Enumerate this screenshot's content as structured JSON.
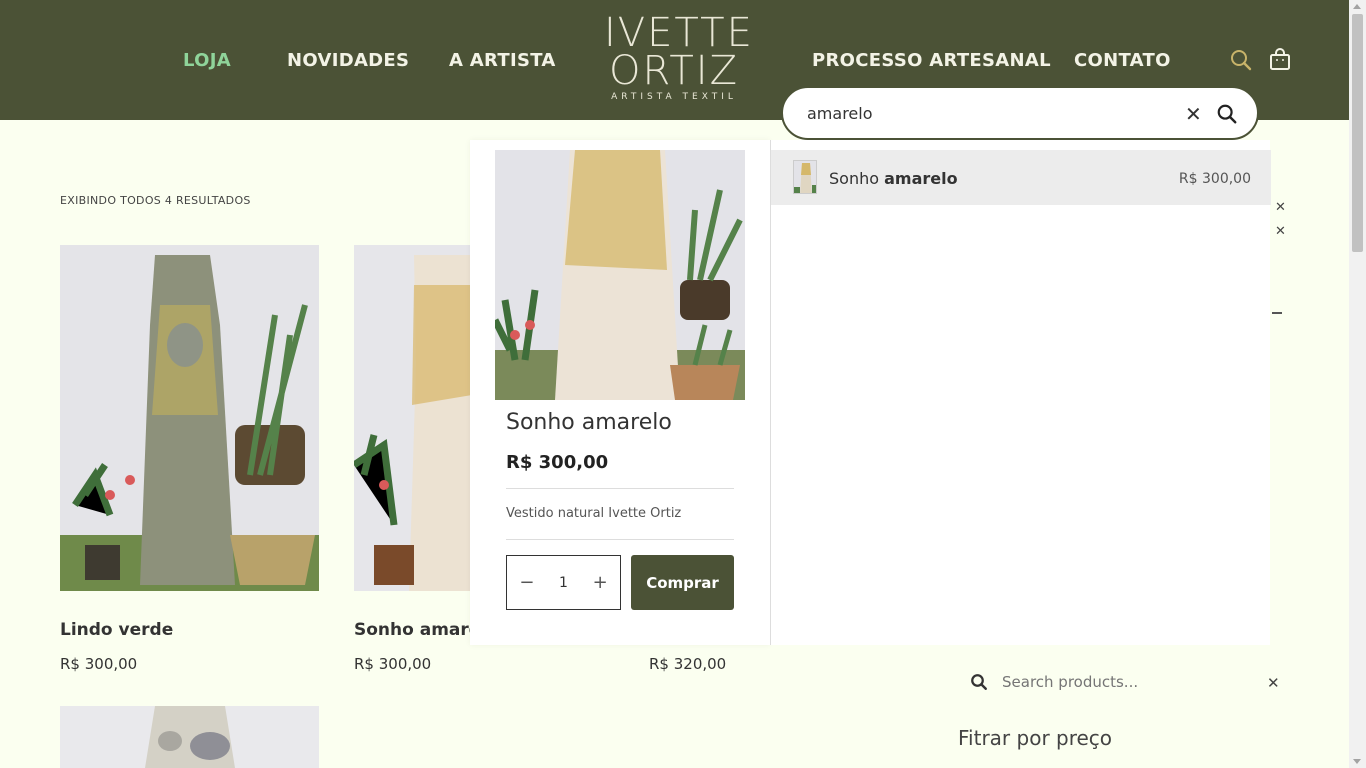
{
  "header": {
    "nav_left": [
      "LOJA",
      "NOVIDADES",
      "A ARTISTA"
    ],
    "nav_right": [
      "PROCESSO ARTESANAL",
      "CONTATO"
    ],
    "logo_line1": "IVETTE",
    "logo_line2": "ORTIZ",
    "logo_tagline": "ARTISTA TEXTIL",
    "icons": [
      "search-icon",
      "cart-icon"
    ]
  },
  "listing": {
    "results_count": "EXIBINDO TODOS 4 RESULTADOS",
    "products": [
      {
        "title": "Lindo verde",
        "price": "R$ 300,00"
      },
      {
        "title": "Sonho amarel",
        "price": "R$ 300,00"
      },
      {
        "title": "",
        "price": "R$ 320,00"
      }
    ]
  },
  "quickview": {
    "title": "Sonho amarelo",
    "price": "R$ 300,00",
    "description": "Vestido natural Ivette Ortiz",
    "quantity": "1",
    "buy_label": "Comprar"
  },
  "search": {
    "query": "amarelo",
    "results": [
      {
        "name_plain": "Sonho ",
        "name_bold": "amarelo",
        "price": "R$ 300,00"
      }
    ]
  },
  "sidebar": {
    "search_placeholder": "Search products...",
    "filter_title": "Fitrar por preço"
  },
  "colors": {
    "header_bg": "#4b5236",
    "page_bg": "#fbfff0",
    "active_nav": "#8fd49a",
    "accent_search_icon": "#c8b46a"
  }
}
